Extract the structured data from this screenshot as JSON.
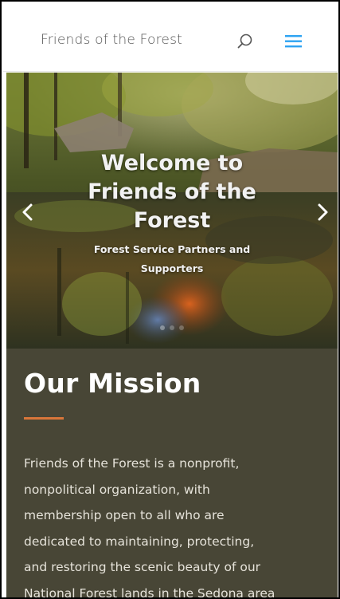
{
  "header": {
    "site_title": "Friends of the Forest",
    "search_icon": "search-icon",
    "menu_icon": "hamburger-menu-icon",
    "menu_color": "#2ea3f2"
  },
  "hero": {
    "title": "Welcome to Friends of the Forest",
    "subtitle": "Forest Service Partners and Supporters",
    "prev_icon": "chevron-left-icon",
    "next_icon": "chevron-right-icon"
  },
  "mission": {
    "title": "Our Mission",
    "divider_color": "#d9763a",
    "lines": [
      "Friends of the Forest is a nonprofit,",
      "nonpolitical organization, with",
      "membership open to all who are",
      "dedicated to maintaining, protecting,",
      "and restoring the scenic beauty of our",
      "National Forest lands in the Sedona area"
    ]
  }
}
